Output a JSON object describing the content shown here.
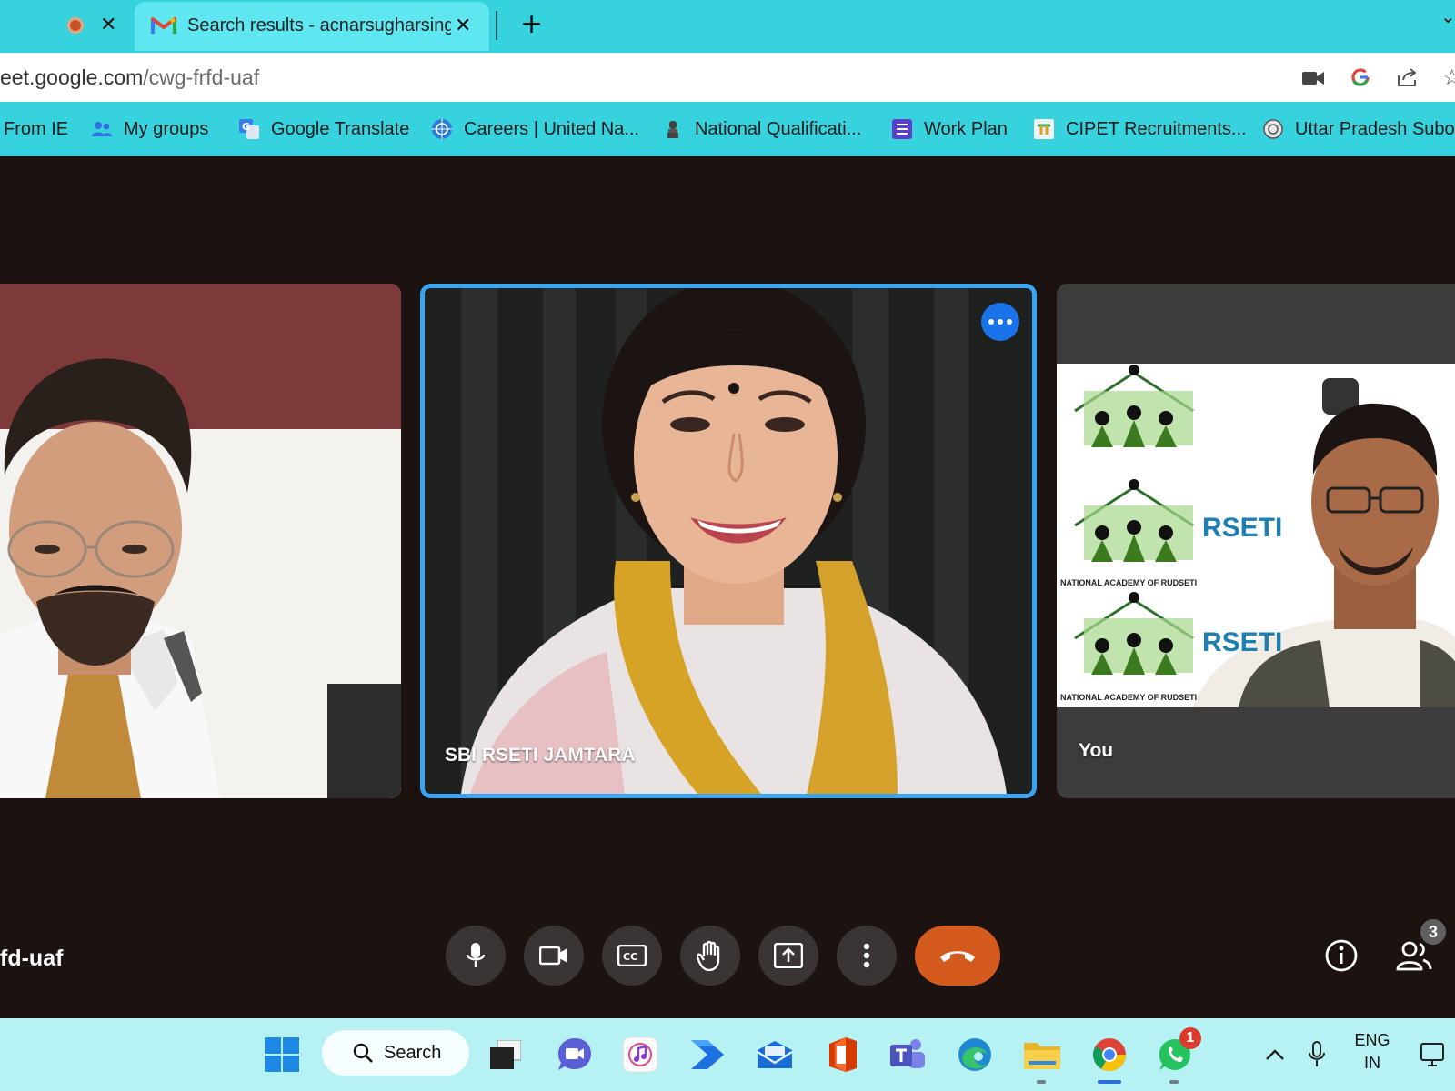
{
  "browser": {
    "tabs": [
      {
        "title": "",
        "recording": true
      },
      {
        "title": "Search results - acnarsugharsingh",
        "active": true
      }
    ],
    "url": {
      "host": "eet.google.com",
      "path": "/cwg-frfd-uaf"
    },
    "bookmarks": [
      {
        "label": "From IE",
        "icon": "folder-icon"
      },
      {
        "label": "My groups",
        "icon": "groups-icon"
      },
      {
        "label": "Google Translate",
        "icon": "translate-icon"
      },
      {
        "label": "Careers | United Na...",
        "icon": "un-emblem-icon"
      },
      {
        "label": "National Qualificati...",
        "icon": "emblem-icon"
      },
      {
        "label": "Work Plan",
        "icon": "list-icon"
      },
      {
        "label": "CIPET Recruitments...",
        "icon": "cipet-icon"
      },
      {
        "label": "Uttar Pradesh Subo...",
        "icon": "up-seal-icon"
      }
    ]
  },
  "meet": {
    "meeting_code": "fd-uaf",
    "tiles": [
      {
        "name": ""
      },
      {
        "name": "SBI RSETI JAMTARA",
        "speaking": true
      },
      {
        "name": "You",
        "banner_brand": "RSETI",
        "banner_caption": "NATIONAL ACADEMY OF RUDSETI"
      }
    ],
    "controls": [
      "mic-icon",
      "camera-icon",
      "captions-icon",
      "raise-hand-icon",
      "present-icon",
      "more-vert-icon",
      "end-call-icon"
    ],
    "participant_count": "3"
  },
  "taskbar": {
    "search_label": "Search",
    "notification_count": "1",
    "language": {
      "line1": "ENG",
      "line2": "IN"
    }
  },
  "colors": {
    "chrome_accent": "#36d3de",
    "speaker_border": "#37a4f4",
    "end_call": "#d45a1d",
    "stage_bg": "#1c120f"
  }
}
